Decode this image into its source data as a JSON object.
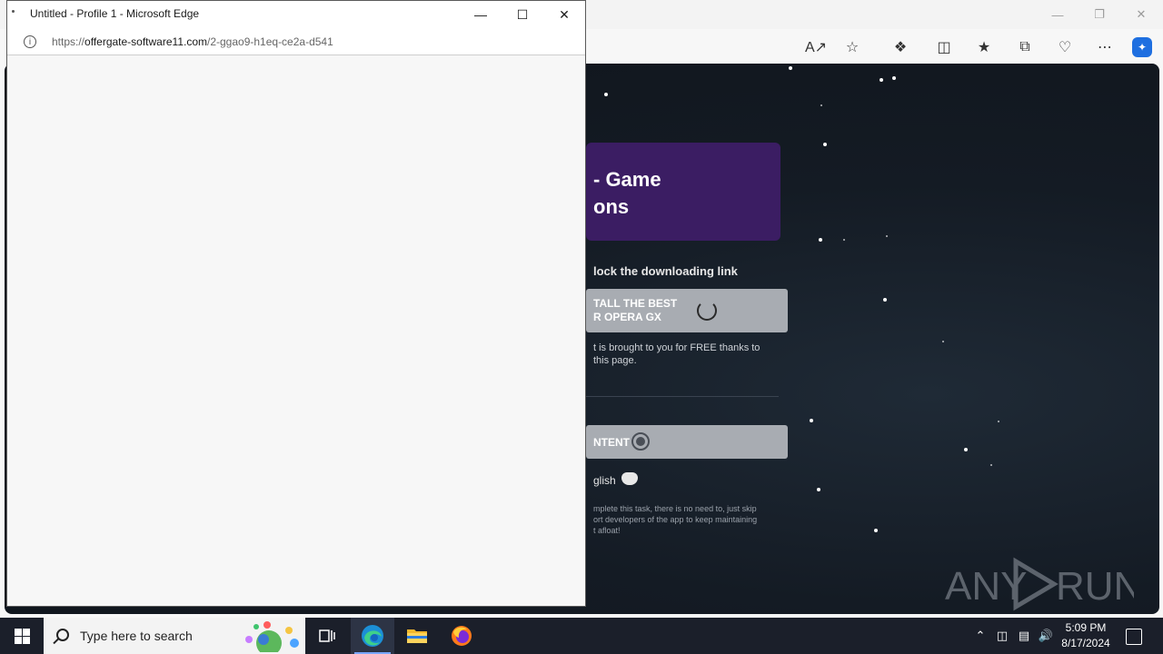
{
  "popup": {
    "title": "Untitled - Profile 1 - Microsoft Edge",
    "url_scheme": "https://",
    "url_host": "offergate-software11.com",
    "url_path": "/2-ggao9-h1eq-ce2a-d541"
  },
  "page": {
    "game_title": "- Game\nons",
    "unlock_text": "lock the downloading link",
    "install_label": "TALL THE BEST\nR OPERA GX",
    "free_text": "t is brought to you for FREE thanks to\nthis page.",
    "content_label": "NTENT",
    "lang_text": "glish",
    "skip_text": "mplete this task, there is no need to, just skip\nort developers of the app to keep maintaining\nt afloat!"
  },
  "watermark": {
    "brand": "ANY RUN"
  },
  "taskbar": {
    "search_placeholder": "Type here to search",
    "time": "5:09 PM",
    "date": "8/17/2024"
  },
  "icons": {
    "start": "windows-logo-icon",
    "task_view": "task-view-icon",
    "edge": "edge-icon",
    "explorer": "file-explorer-icon",
    "firefox": "firefox-icon"
  },
  "colors": {
    "card_purple": "#3b1d63",
    "taskbar": "#1b1f2a",
    "copilot_blue": "#1e6fe0"
  }
}
